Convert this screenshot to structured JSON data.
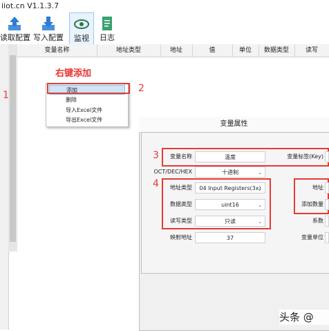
{
  "window": {
    "title": "iiot.cn V1.1.3.7"
  },
  "toolbar": {
    "items": [
      {
        "label": "读取配置",
        "icon": "upload-icon"
      },
      {
        "label": "写入配置",
        "icon": "download-icon"
      },
      {
        "label": "监视",
        "icon": "eye-icon"
      },
      {
        "label": "日志",
        "icon": "document-icon"
      }
    ]
  },
  "table": {
    "columns": [
      "变量名称",
      "地址类型",
      "地址",
      "值",
      "单位",
      "数据类型",
      "读写"
    ]
  },
  "annotations": {
    "right_click_add": "右键添加",
    "n1": "1",
    "n2": "2",
    "n3": "3",
    "n4": "4"
  },
  "context_menu": {
    "items": [
      "添加",
      "删除",
      "导入Excel文件",
      "导出Excel文件"
    ]
  },
  "dialog": {
    "title": "变量属性",
    "var_name_label": "变量名称",
    "var_name_value": "温度",
    "var_tag_label": "变量标签(Key)",
    "format_label": "OCT/DEC/HEX",
    "format_value": "十进制",
    "addr_type_label": "地址类型",
    "addr_type_value": "04 Input Registers(3x)",
    "data_type_label": "数据类型",
    "data_type_value": "uint16",
    "rw_type_label": "读写类型",
    "rw_type_value": "只读",
    "map_addr_label": "映射地址",
    "map_addr_value": "37",
    "address_label": "地址",
    "add_count_label": "添加数量",
    "factor_label": "系数",
    "unit_label": "变量单位"
  },
  "watermark": {
    "text": "头条 @"
  }
}
